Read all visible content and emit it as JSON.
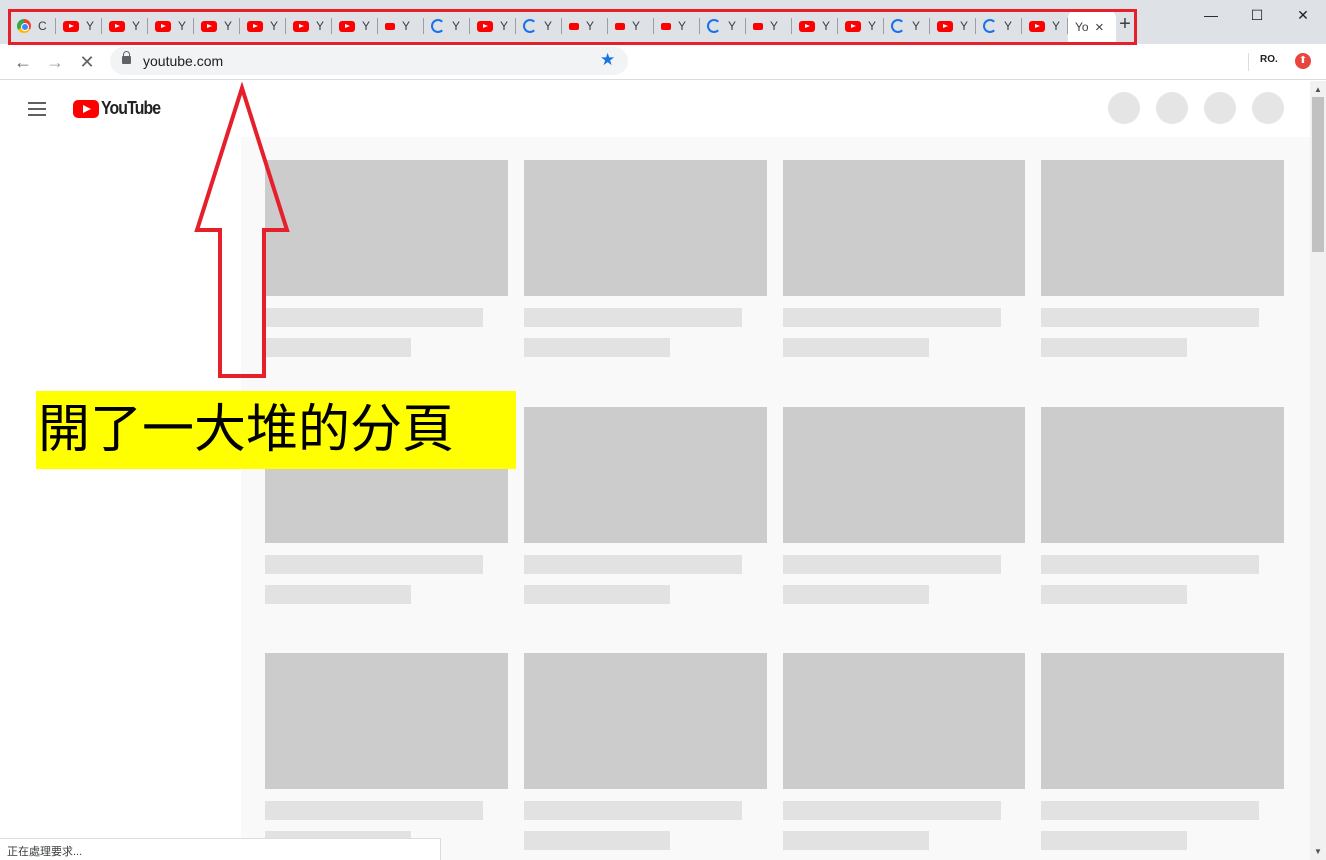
{
  "browser": {
    "tabs": [
      {
        "letter": "C",
        "favicon": "chrome-icon"
      },
      {
        "letter": "Y",
        "favicon": "youtube-icon"
      },
      {
        "letter": "Y",
        "favicon": "youtube-icon"
      },
      {
        "letter": "Y",
        "favicon": "youtube-icon"
      },
      {
        "letter": "Y",
        "favicon": "youtube-icon"
      },
      {
        "letter": "Y",
        "favicon": "youtube-icon"
      },
      {
        "letter": "Y",
        "favicon": "youtube-icon"
      },
      {
        "letter": "Y",
        "favicon": "youtube-icon"
      },
      {
        "letter": "Y",
        "favicon": "youtube-small-icon"
      },
      {
        "letter": "Y",
        "favicon": "loading-icon"
      },
      {
        "letter": "Y",
        "favicon": "youtube-icon"
      },
      {
        "letter": "Y",
        "favicon": "loading-icon"
      },
      {
        "letter": "Y",
        "favicon": "youtube-small-icon"
      },
      {
        "letter": "Y",
        "favicon": "youtube-small-icon"
      },
      {
        "letter": "Y",
        "favicon": "youtube-small-icon"
      },
      {
        "letter": "Y",
        "favicon": "loading-icon"
      },
      {
        "letter": "Y",
        "favicon": "youtube-small-icon"
      },
      {
        "letter": "Y",
        "favicon": "youtube-icon"
      },
      {
        "letter": "Y",
        "favicon": "youtube-icon"
      },
      {
        "letter": "Y",
        "favicon": "loading-icon"
      },
      {
        "letter": "Y",
        "favicon": "youtube-icon"
      },
      {
        "letter": "Y",
        "favicon": "loading-icon"
      },
      {
        "letter": "Y",
        "favicon": "youtube-icon"
      }
    ],
    "active_tab": {
      "letter": "Yo",
      "close": "×"
    },
    "new_tab": "+",
    "window_controls": {
      "minimize": "—",
      "maximize": "☐",
      "close": "✕"
    },
    "address": "youtube.com",
    "profile": "RO.",
    "status_text": "正在處理要求..."
  },
  "youtube": {
    "logo_text": "YouTube",
    "grid_rows": 3,
    "grid_cols": 4
  },
  "annotation": {
    "caption": "開了一大堆的分頁",
    "color": "#e5202b",
    "highlight": "#ffff00"
  }
}
